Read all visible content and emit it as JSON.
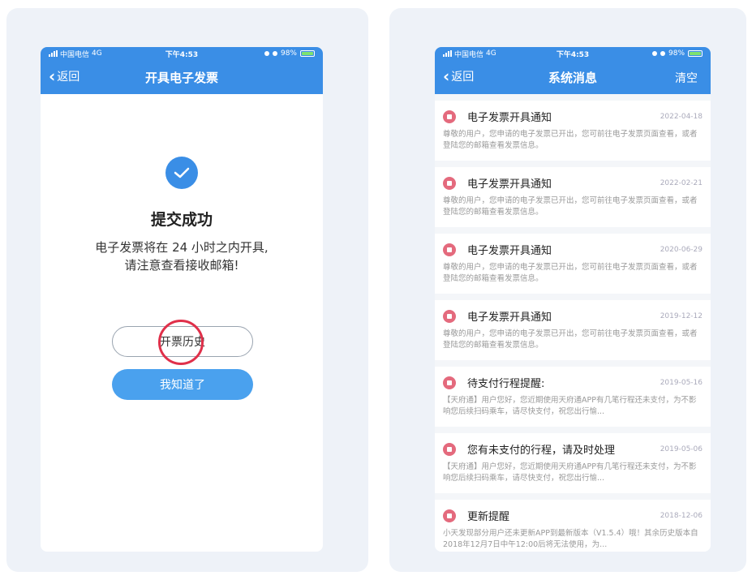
{
  "status_bar": {
    "carrier": "中国电信",
    "network": "4G",
    "time": "下午4:53",
    "battery": "98%"
  },
  "left_screen": {
    "back_label": "返回",
    "title": "开具电子发票",
    "success_title": "提交成功",
    "desc_line1": "电子发票将在 24 小时之内开具,",
    "desc_line2": "请注意查看接收邮箱!",
    "history_button": "开票历史",
    "ok_button": "我知道了"
  },
  "right_screen": {
    "back_label": "返回",
    "title": "系统消息",
    "clear_label": "清空",
    "messages": [
      {
        "title": "电子发票开具通知",
        "date": "2022-04-18",
        "body": "尊敬的用户，您申请的电子发票已开出，您可前往电子发票页面查看，或者登陆您的邮箱查看发票信息。"
      },
      {
        "title": "电子发票开具通知",
        "date": "2022-02-21",
        "body": "尊敬的用户，您申请的电子发票已开出，您可前往电子发票页面查看，或者登陆您的邮箱查看发票信息。"
      },
      {
        "title": "电子发票开具通知",
        "date": "2020-06-29",
        "body": "尊敬的用户，您申请的电子发票已开出，您可前往电子发票页面查看，或者登陆您的邮箱查看发票信息。"
      },
      {
        "title": "电子发票开具通知",
        "date": "2019-12-12",
        "body": "尊敬的用户，您申请的电子发票已开出，您可前往电子发票页面查看，或者登陆您的邮箱查看发票信息。"
      },
      {
        "title": "待支付行程提醒:",
        "date": "2019-05-16",
        "body": "【天府通】用户您好，您近期使用天府通APP有几笔行程还未支付，为不影响您后续扫码乘车，请尽快支付，祝您出行愉..."
      },
      {
        "title": "您有未支付的行程，请及时处理",
        "date": "2019-05-06",
        "body": "【天府通】用户您好，您近期使用天府通APP有几笔行程还未支付，为不影响您后续扫码乘车，请尽快支付，祝您出行愉..."
      },
      {
        "title": "更新提醒",
        "date": "2018-12-06",
        "body": "小天发现部分用户还未更新APP到最新版本（V1.5.4）哦！其余历史版本自2018年12月7日中午12:00后将无法使用，为..."
      }
    ]
  },
  "colors": {
    "accent": "#3a8ee6",
    "button_blue": "#4aa1ee",
    "message_icon": "#e46a7d",
    "highlight_ring": "#e0304a"
  }
}
